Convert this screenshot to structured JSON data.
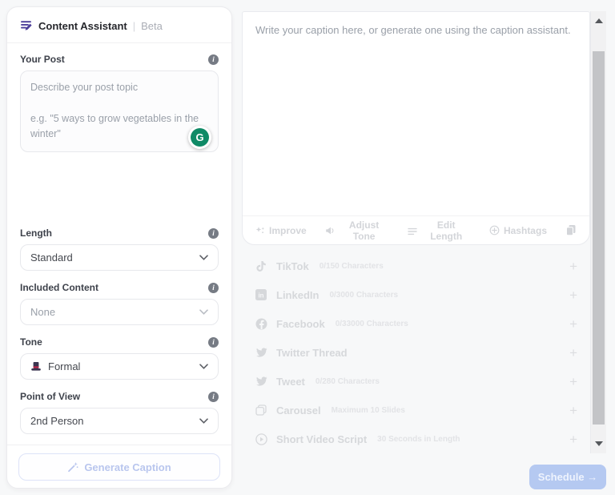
{
  "colors": {
    "accent_purple": "#4d3f9a",
    "grammarly_green": "#0f8a66",
    "tone_hat_body": "#3b3550",
    "tone_hat_band": "#c0264b",
    "schedule_blue": "#b5c9f1",
    "disabled_button_text": "#b9c6ee"
  },
  "assistant": {
    "title": "Content Assistant",
    "divider": "|",
    "badge": "Beta",
    "post": {
      "label": "Your Post",
      "placeholder": "Describe your post topic\n\ne.g. \"5 ways to grow vegetables in the winter\""
    },
    "grammarly_letter": "G",
    "fields": [
      {
        "label": "Length",
        "value": "Standard"
      },
      {
        "label": "Included Content",
        "value": "None"
      },
      {
        "label": "Tone",
        "value": "Formal"
      },
      {
        "label": "Point of View",
        "value": "2nd Person"
      }
    ],
    "generate_label": "Generate Caption"
  },
  "editor": {
    "placeholder": "Write your caption here, or generate one using the caption assistant.",
    "tools": [
      {
        "label": "Improve"
      },
      {
        "label": "Adjust Tone"
      },
      {
        "label": "Edit Length"
      },
      {
        "label": "Hashtags"
      }
    ]
  },
  "platforms": [
    {
      "name": "TikTok",
      "detail": "0/150 Characters"
    },
    {
      "name": "LinkedIn",
      "detail": "0/3000 Characters"
    },
    {
      "name": "Facebook",
      "detail": "0/33000 Characters"
    },
    {
      "name": "Twitter Thread",
      "detail": ""
    },
    {
      "name": "Tweet",
      "detail": "0/280 Characters"
    },
    {
      "name": "Carousel",
      "detail": "Maximum 10 Slides"
    },
    {
      "name": "Short Video Script",
      "detail": "30 Seconds in Length"
    }
  ],
  "schedule_label": "Schedule →"
}
